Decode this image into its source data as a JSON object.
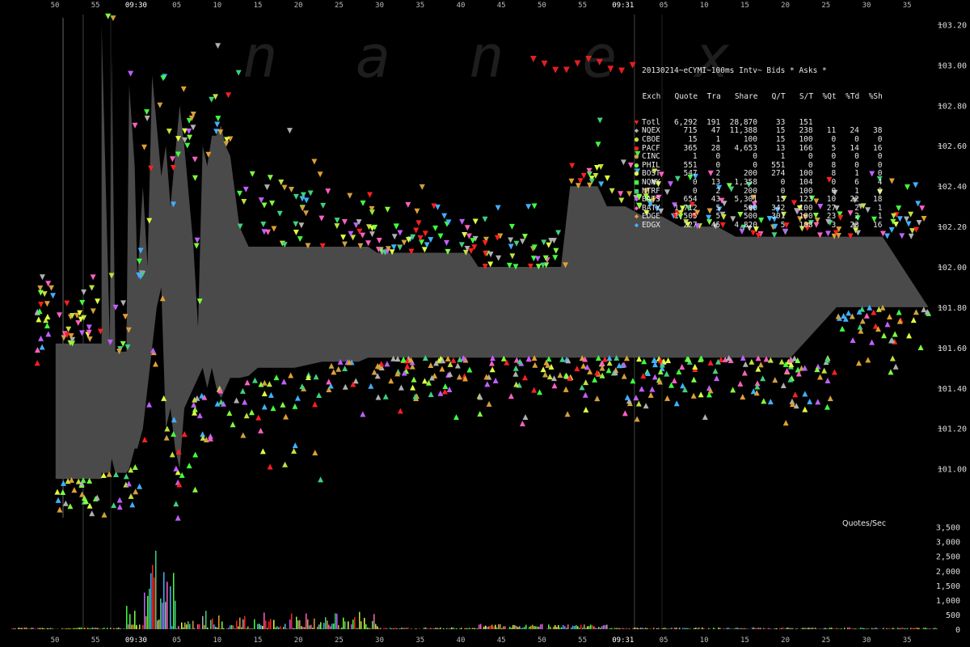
{
  "chart_data": {
    "type": "scatter",
    "watermark": "nanex",
    "title": "20130214~eCYMI~100ms Intv~ Bids * Asks *",
    "price_axis": {
      "ylim": [
        100.75,
        103.25
      ],
      "ticks": [
        101.0,
        101.2,
        101.4,
        101.6,
        101.8,
        102.0,
        102.2,
        102.4,
        102.6,
        102.8,
        103.0,
        103.2
      ],
      "tick_labels": [
        "101.00",
        "101.20",
        "101.40",
        "101.60",
        "101.80",
        "102.00",
        "102.20",
        "102.40",
        "102.60",
        "102.80",
        "103.00",
        "103.20"
      ]
    },
    "rate_axis": {
      "label": "Quotes/Sec",
      "ylim": [
        0,
        3600
      ],
      "ticks": [
        0,
        500,
        1000,
        1500,
        2000,
        2500,
        3000,
        3500
      ],
      "tick_labels": [
        "0",
        "500",
        "1,000",
        "1,500",
        "2,000",
        "2,500",
        "3,000",
        "3,500"
      ]
    },
    "x_axis": {
      "tick_labels": [
        "50",
        "55",
        "09:30",
        "05",
        "10",
        "15",
        "20",
        "25",
        "30",
        "35",
        "40",
        "45",
        "50",
        "55",
        "09:31",
        "05",
        "10",
        "15",
        "20",
        "25",
        "30",
        "35"
      ],
      "major_labels": [
        "09:30",
        "09:31"
      ]
    },
    "legend": {
      "header": [
        "Exch",
        "Quote",
        "Tra",
        "Share",
        "Q/T",
        "S/T",
        "%Qt",
        "%Td",
        "%Sh"
      ],
      "rows": [
        {
          "exch": "Totl",
          "quote": "6,292",
          "tra": "191",
          "share": "28,870",
          "qt": "33",
          "st": "151",
          "pqt": "",
          "ptd": "",
          "psh": "",
          "color": "#ff2020",
          "marker": "▼"
        },
        {
          "exch": "NQEX",
          "quote": "715",
          "tra": "47",
          "share": "11,388",
          "qt": "15",
          "st": "238",
          "pqt": "11",
          "ptd": "24",
          "psh": "38",
          "color": "#b0b0b0",
          "marker": "◆"
        },
        {
          "exch": "CBOE",
          "quote": "15",
          "tra": "1",
          "share": "100",
          "qt": "15",
          "st": "100",
          "pqt": "0",
          "ptd": "0",
          "psh": "0",
          "color": "#c0e040",
          "marker": "●"
        },
        {
          "exch": "PACF",
          "quote": "365",
          "tra": "28",
          "share": "4,653",
          "qt": "13",
          "st": "166",
          "pqt": "5",
          "ptd": "14",
          "psh": "16",
          "color": "#ff2020",
          "marker": "●"
        },
        {
          "exch": "CINC",
          "quote": "1",
          "tra": "0",
          "share": "0",
          "qt": "1",
          "st": "0",
          "pqt": "0",
          "ptd": "0",
          "psh": "0",
          "color": "#d0a040",
          "marker": "●"
        },
        {
          "exch": "PHIL",
          "quote": "551",
          "tra": "0",
          "share": "0",
          "qt": "551",
          "st": "0",
          "pqt": "8",
          "ptd": "0",
          "psh": "0",
          "color": "#80ff40",
          "marker": "●"
        },
        {
          "exch": "BOST",
          "quote": "547",
          "tra": "2",
          "share": "200",
          "qt": "274",
          "st": "100",
          "pqt": "8",
          "ptd": "1",
          "psh": "0",
          "color": "#e0ff40",
          "marker": "●"
        },
        {
          "exch": "NQNX",
          "quote": "0",
          "tra": "13",
          "share": "1,358",
          "qt": "0",
          "st": "104",
          "pqt": "0",
          "ptd": "6",
          "psh": "4",
          "color": "#40ff40",
          "marker": "■"
        },
        {
          "exch": "NTRF",
          "quote": "0",
          "tra": "2",
          "share": "200",
          "qt": "0",
          "st": "100",
          "pqt": "0",
          "ptd": "1",
          "psh": "0",
          "color": "#40d080",
          "marker": "■"
        },
        {
          "exch": "BATS",
          "quote": "654",
          "tra": "43",
          "share": "5,301",
          "qt": "15",
          "st": "123",
          "pqt": "10",
          "ptd": "22",
          "psh": "18",
          "color": "#c060ff",
          "marker": "◆"
        },
        {
          "exch": "BATY",
          "quote": "1,712",
          "tra": "5",
          "share": "500",
          "qt": "342",
          "st": "100",
          "pqt": "27",
          "ptd": "2",
          "psh": "1",
          "color": "#ff60c0",
          "marker": "◆"
        },
        {
          "exch": "EDGE",
          "quote": "1,505",
          "tra": "5",
          "share": "500",
          "qt": "301",
          "st": "100",
          "pqt": "23",
          "ptd": "2",
          "psh": "1",
          "color": "#e0a030",
          "marker": "◆"
        },
        {
          "exch": "EDGX",
          "quote": "227",
          "tra": "45",
          "share": "4,820",
          "qt": "5",
          "st": "108",
          "pqt": "3",
          "ptd": "23",
          "psh": "16",
          "color": "#40b0ff",
          "marker": "◆"
        }
      ]
    },
    "nbbo_spread": {
      "color": "#4a4a4a",
      "t": [
        0,
        3,
        3,
        5,
        5,
        5.9,
        6.1,
        6.5,
        7.7,
        8,
        8.6,
        8.9,
        9.5,
        10,
        10.5,
        11,
        11.5,
        12,
        12.5,
        13,
        13.5,
        14,
        15,
        15.5,
        16,
        16.5,
        17,
        17.5,
        18,
        18.5,
        19,
        20,
        21,
        22,
        23,
        24,
        25,
        26,
        27,
        28,
        29,
        30,
        31,
        32,
        33,
        34,
        35,
        36,
        38,
        40,
        45,
        46,
        50,
        55,
        56,
        59,
        60,
        62,
        64,
        65,
        66,
        68,
        70,
        72,
        74,
        75,
        80,
        85,
        86,
        88,
        89,
        90,
        95
      ],
      "bid": [
        100.95,
        100.95,
        100.95,
        100.95,
        100.98,
        100.98,
        101.05,
        100.98,
        100.98,
        101.0,
        101.1,
        101.1,
        101.2,
        101.4,
        101.6,
        101.8,
        101.9,
        101.2,
        101.3,
        101.1,
        101.0,
        101.3,
        101.4,
        101.45,
        101.5,
        101.4,
        101.5,
        101.4,
        101.35,
        101.4,
        101.45,
        101.45,
        101.46,
        101.5,
        101.5,
        101.5,
        101.5,
        101.5,
        101.51,
        101.52,
        101.53,
        101.53,
        101.53,
        101.53,
        101.53,
        101.55,
        101.55,
        101.55,
        101.55,
        101.55,
        101.55,
        101.55,
        101.55,
        101.55,
        101.55,
        101.55,
        101.55,
        101.55,
        101.55,
        101.55,
        101.55,
        101.55,
        101.55,
        101.55,
        101.55,
        101.55,
        101.55,
        101.8,
        101.8,
        101.8,
        101.8,
        101.8,
        101.8
      ],
      "ask": [
        101.62,
        101.62,
        101.62,
        101.62,
        103.2,
        101.62,
        103.05,
        101.58,
        101.58,
        102.9,
        102.5,
        101.95,
        102.4,
        102.0,
        102.95,
        102.7,
        102.45,
        102.6,
        102.3,
        102.55,
        102.8,
        102.6,
        102.1,
        101.7,
        102.6,
        102.5,
        102.65,
        102.65,
        102.7,
        102.6,
        102.55,
        102.2,
        102.1,
        102.1,
        102.1,
        102.1,
        102.1,
        102.1,
        102.1,
        102.1,
        102.1,
        102.1,
        102.1,
        102.1,
        102.1,
        102.1,
        102.07,
        102.07,
        102.07,
        102.07,
        102.07,
        102.0,
        102.0,
        102.0,
        102.4,
        102.4,
        102.3,
        102.3,
        102.25,
        102.25,
        102.25,
        102.2,
        102.2,
        102.2,
        102.15,
        102.15,
        102.15,
        102.15,
        102.15,
        102.15,
        102.15,
        102.15,
        101.8
      ]
    },
    "x_range": {
      "min": -5,
      "max": 96
    }
  }
}
